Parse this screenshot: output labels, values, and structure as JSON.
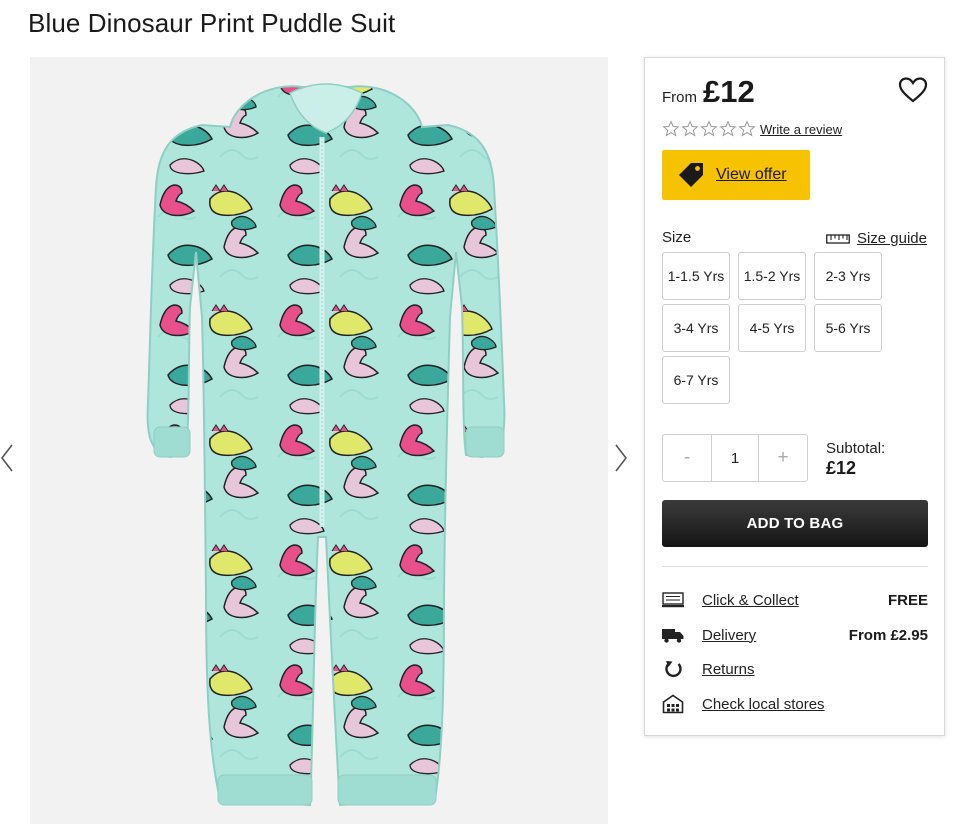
{
  "product": {
    "title": "Blue Dinosaur Print Puddle Suit",
    "image_alt": "Mint green puddle suit with colourful dinosaur print"
  },
  "pricing": {
    "from_label": "From",
    "price": "£12"
  },
  "rating": {
    "stars_filled": 0,
    "stars_total": 5,
    "write_review_label": "Write a review"
  },
  "offer": {
    "label": "View offer",
    "color": "#f7c200"
  },
  "size": {
    "label": "Size",
    "guide_label": "Size guide",
    "options": [
      "1-1.5 Yrs",
      "1.5-2 Yrs",
      "2-3 Yrs",
      "3-4 Yrs",
      "4-5 Yrs",
      "5-6 Yrs",
      "6-7 Yrs"
    ]
  },
  "quantity": {
    "minus_label": "-",
    "value": "1",
    "plus_label": "+"
  },
  "subtotal": {
    "label": "Subtotal:",
    "value": "£12"
  },
  "cart": {
    "add_label": "ADD TO BAG"
  },
  "services": [
    {
      "label": "Click & Collect",
      "value": "FREE",
      "icon": "click-collect-icon"
    },
    {
      "label": "Delivery",
      "value": "From £2.95",
      "icon": "truck-icon"
    },
    {
      "label": "Returns",
      "value": "",
      "icon": "returns-icon"
    },
    {
      "label": "Check local stores",
      "value": "",
      "icon": "store-icon"
    }
  ],
  "colors": {
    "suit": "#aee6dc",
    "dino_pink": "#e8508c",
    "dino_yellow": "#dfe86a",
    "dino_teal": "#3aa89a",
    "dino_lilac": "#e6c6d8"
  }
}
